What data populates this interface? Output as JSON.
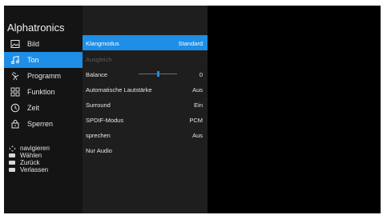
{
  "app": {
    "brand": "Alphatronics"
  },
  "colors": {
    "accent": "#1e8ee6",
    "sidebar_bg": "#141414",
    "panel_bg": "#1e1e1e"
  },
  "sidebar": {
    "items": [
      {
        "label": "Bild",
        "icon": "picture-icon",
        "active": false
      },
      {
        "label": "Ton",
        "icon": "music-note-icon",
        "active": true
      },
      {
        "label": "Programm",
        "icon": "satellite-dish-icon",
        "active": false
      },
      {
        "label": "Funktion",
        "icon": "grid-icon",
        "active": false
      },
      {
        "label": "Zeit",
        "icon": "clock-icon",
        "active": false
      },
      {
        "label": "Sperren",
        "icon": "lock-icon",
        "active": false
      }
    ]
  },
  "hints": [
    {
      "icon": "dpad-icon",
      "label": "navigieren"
    },
    {
      "icon": "ok-key-icon",
      "label": "Wählen"
    },
    {
      "icon": "back-key-icon",
      "label": "Zurück"
    },
    {
      "icon": "exit-key-icon",
      "label": "Verlassen"
    }
  ],
  "settings": {
    "rows": [
      {
        "label": "Klangmodus",
        "value": "Standard",
        "state": "active"
      },
      {
        "label": "Ausgleich",
        "value": "",
        "state": "disabled"
      },
      {
        "label": "Balance",
        "value": "0",
        "state": "normal",
        "slider_fraction": 0.5
      },
      {
        "label": "Automatische Lautstärke",
        "value": "Aus",
        "state": "normal"
      },
      {
        "label": "Surround",
        "value": "Ein",
        "state": "normal"
      },
      {
        "label": "SPDIF-Modus",
        "value": "PCM",
        "state": "normal"
      },
      {
        "label": "sprechen",
        "value": "Aus",
        "state": "normal"
      },
      {
        "label": "Nur Audio",
        "value": "",
        "state": "normal"
      }
    ]
  }
}
